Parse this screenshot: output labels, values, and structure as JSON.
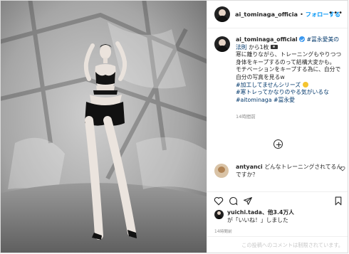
{
  "header": {
    "username": "ai_tominaga_officia",
    "separator": "•",
    "follow_label": "フォローする",
    "more_icon": "more-horizontal-icon"
  },
  "caption": {
    "username": "ai_tominaga_official",
    "tag_tominaga_method": "#冨永愛美の法則",
    "line1_rest": " から1枚",
    "line2": "寒に離りながら、トレーニングもやりつつ身体をキープするのって結構大変かも。",
    "line3": "モチベーションをキープする為に、自分で自分の写真を見るw",
    "tag_not_edited": "#加工してませんシリーズ",
    "tag_training": "#寒トレってかなりのやる気がいるな",
    "tag_aitominaga": "#aitominaga",
    "tag_tominaga": "#冨永愛",
    "time_ago": "14時間前",
    "verified_icon": "verified-badge-icon"
  },
  "comment": {
    "username": "antyanci",
    "text": "どんなトレーニングされてるんですか？"
  },
  "actions": {
    "icons": [
      "heart-icon",
      "comment-icon",
      "share-icon",
      "bookmark-icon"
    ]
  },
  "likes": {
    "user": "yuichi.tada",
    "rest": "、他3.4万人",
    "line2": "が「いいね！」しました"
  },
  "timestamp": "14時間前",
  "comment_disabled": "この投稿へのコメントは制限されています。",
  "colors": {
    "link": "#0095f6",
    "hashtag": "#00376b",
    "muted": "#8e8e8e"
  }
}
